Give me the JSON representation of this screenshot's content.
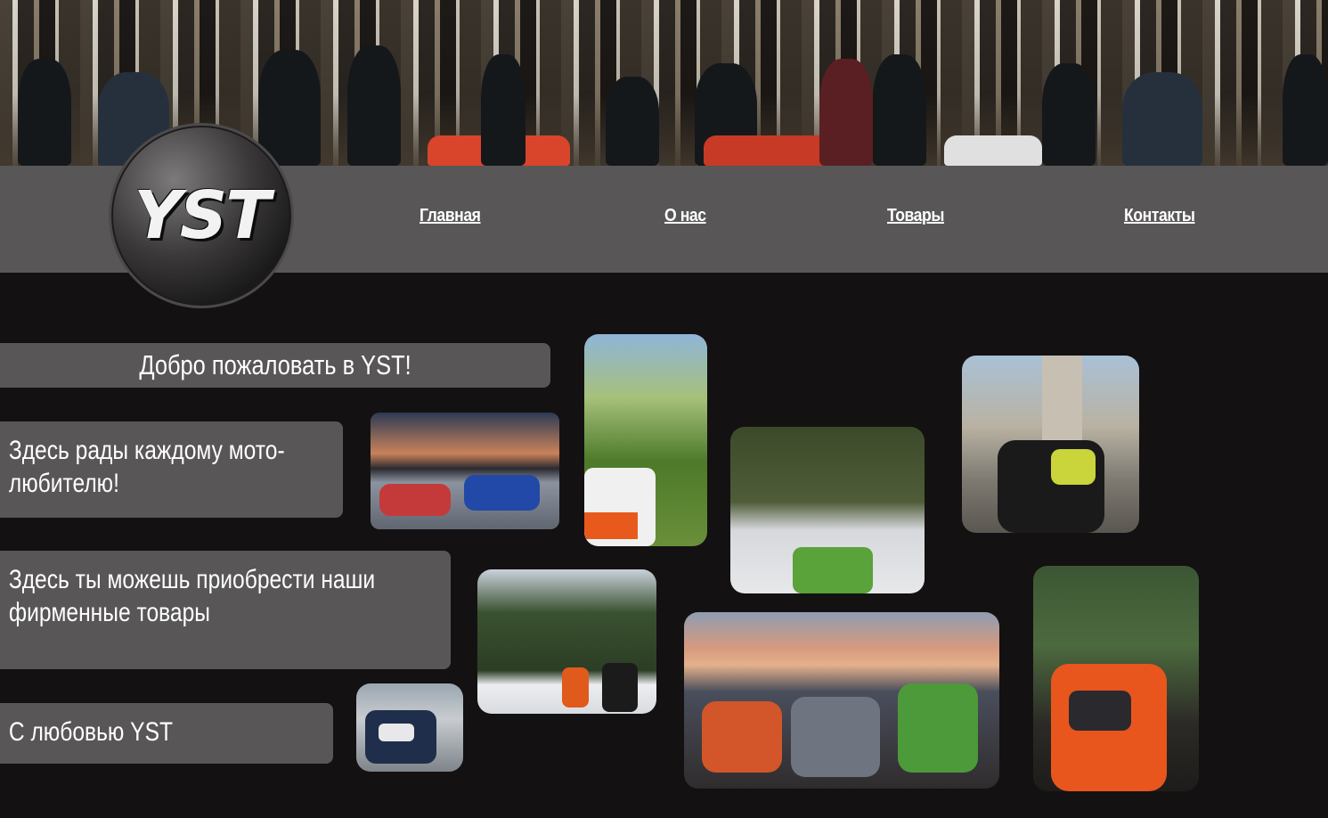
{
  "nav": {
    "home": "Главная",
    "about": "О нас",
    "products": "Товары",
    "contacts": "Контакты"
  },
  "logo": {
    "text": "YST"
  },
  "main": {
    "welcome": "Добро пожаловать в YST!",
    "line1": "Здесь рады каждому мото-любителю!",
    "line2": "Здесь ты можешь приобрести наши фирменные товары",
    "line3": "С любовью YST"
  },
  "colors": {
    "background": "#141112",
    "navbar": "#585657",
    "text": "#ffffff"
  },
  "icons": {
    "logo": "yst-graffiti-logo"
  }
}
